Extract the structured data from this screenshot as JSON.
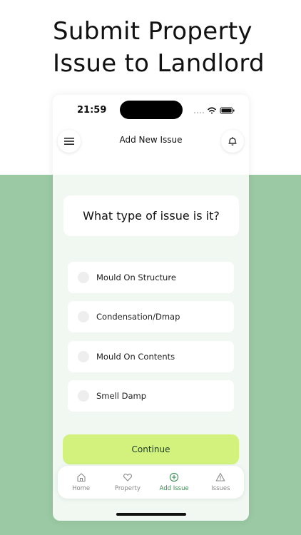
{
  "headline": "Submit Property Issue to Landlord",
  "status_bar": {
    "time": "21:59"
  },
  "nav": {
    "title": "Add New Issue"
  },
  "question": "What type of issue is it?",
  "options": [
    {
      "label": "Mould On Structure"
    },
    {
      "label": "Condensation/Dmap"
    },
    {
      "label": "Mould On Contents"
    },
    {
      "label": "Smell Damp"
    }
  ],
  "continue_label": "Continue",
  "tabs": [
    {
      "label": "Home",
      "icon": "home-icon"
    },
    {
      "label": "Property",
      "icon": "heart-icon"
    },
    {
      "label": "Add Issue",
      "icon": "plus-circle-icon",
      "active": true
    },
    {
      "label": "Issues",
      "icon": "warning-icon"
    }
  ],
  "colors": {
    "background_green": "#9ac9a3",
    "accent_green": "#3c8a55",
    "button_lime": "#d2f27d",
    "phone_bg": "#f1f8f2"
  }
}
